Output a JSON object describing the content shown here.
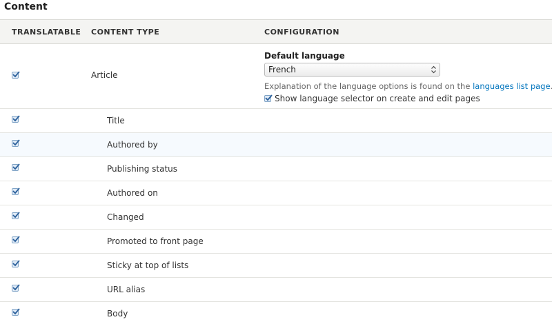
{
  "section": {
    "title": "Content"
  },
  "table": {
    "headers": {
      "translatable": "TRANSLATABLE",
      "content_type": "CONTENT TYPE",
      "configuration": "CONFIGURATION"
    },
    "article": {
      "label": "Article",
      "translatable": true,
      "config": {
        "heading": "Default language",
        "select_value": "French",
        "description_prefix": "Explanation of the language options is found on the ",
        "link_text": "languages list page",
        "description_suffix": ".",
        "show_selector_label": "Show language selector on create and edit pages",
        "show_selector_checked": true
      }
    },
    "fields": [
      {
        "label": "Title",
        "translatable": true
      },
      {
        "label": "Authored by",
        "translatable": true
      },
      {
        "label": "Publishing status",
        "translatable": true
      },
      {
        "label": "Authored on",
        "translatable": true
      },
      {
        "label": "Changed",
        "translatable": true
      },
      {
        "label": "Promoted to front page",
        "translatable": true
      },
      {
        "label": "Sticky at top of lists",
        "translatable": true
      },
      {
        "label": "URL alias",
        "translatable": true
      },
      {
        "label": "Body",
        "translatable": true
      }
    ]
  },
  "colors": {
    "link": "#0074bd",
    "checkbox_border": "#7fa3c6",
    "checkbox_fill": "#dfeaf6",
    "check_mark": "#2a5f9a"
  }
}
